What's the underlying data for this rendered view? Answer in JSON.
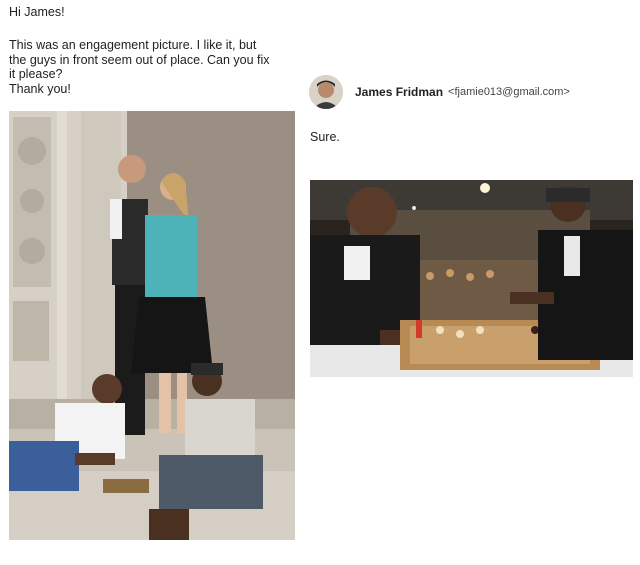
{
  "message": {
    "greeting": "Hi James!",
    "request_lines": [
      "This was an engagement picture. I like it, but",
      "the guys in front seem out of place. Can you fix",
      "it please?",
      "Thank you!"
    ]
  },
  "reply": {
    "sender_name": "James Fridman",
    "sender_email": "<fjamie013@gmail.com>",
    "text": "Sure."
  }
}
